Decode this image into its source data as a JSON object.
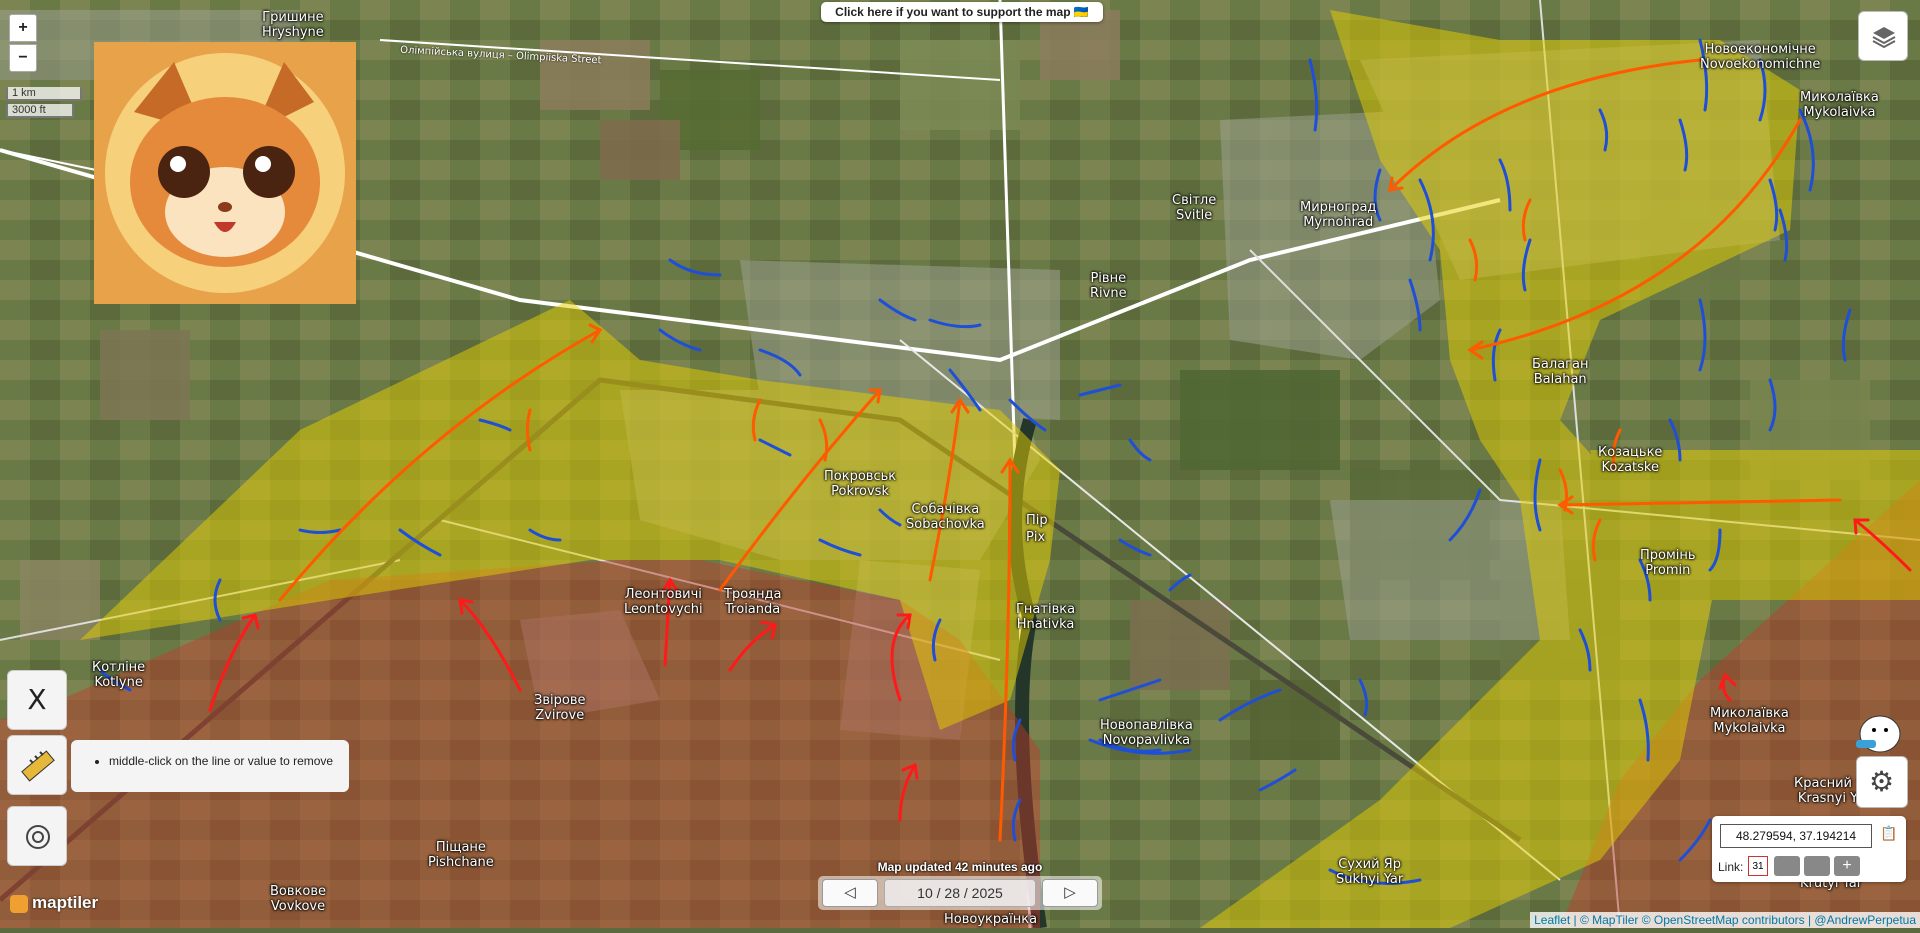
{
  "support_banner": "Click here if you want to support the map 🇺🇦",
  "zoom": {
    "in": "+",
    "out": "−"
  },
  "scale": {
    "metric": "1 km",
    "imperial": "3000 ft"
  },
  "road_label": "Олімпійська вулиця – Olimpiiska Street",
  "places": [
    {
      "uk": "Гришине",
      "en": "Hryshyne"
    },
    {
      "uk": "Світле",
      "en": "Svitle"
    },
    {
      "uk": "Мирноград",
      "en": "Myrnohrad"
    },
    {
      "uk": "Рівне",
      "en": "Rivne"
    },
    {
      "uk": "Новоекономічне",
      "en": "Novoekonomichne"
    },
    {
      "uk": "Миколаївка",
      "en": "Mykolaivka"
    },
    {
      "uk": "Балаган",
      "en": "Balahan"
    },
    {
      "uk": "Козацьке",
      "en": "Kozatske"
    },
    {
      "uk": "Промінь",
      "en": "Promin"
    },
    {
      "uk": "Покровськ",
      "en": "Pokrovsk"
    },
    {
      "uk": "Собачівка",
      "en": "Sobachovka"
    },
    {
      "uk": "Пір",
      "en": "Pir"
    },
    {
      "uk": "Ріх",
      "en": "Rih"
    },
    {
      "uk": "Леонтовичі",
      "en": "Leontovychi"
    },
    {
      "uk": "Троянда",
      "en": "Troianda"
    },
    {
      "uk": "Гнатівка",
      "en": "Hnativka"
    },
    {
      "uk": "Котліне",
      "en": "Kotlyne"
    },
    {
      "uk": "Звірове",
      "en": "Zvirove"
    },
    {
      "uk": "Новопавлівка",
      "en": "Novopavlivka"
    },
    {
      "uk": "Миколаївка",
      "en": "Mykolaivka"
    },
    {
      "uk": "Красний Яр",
      "en": "Krasnyi Yar"
    },
    {
      "uk": "Сухий Яр",
      "en": "Sukhyi Yar"
    },
    {
      "uk": "Піщане",
      "en": "Pishchane"
    },
    {
      "uk": "Вовкове",
      "en": "Vovkove"
    },
    {
      "uk": "Новоукраїнка",
      "en": "Novoukrainka"
    },
    {
      "uk": "",
      "en": "Krutyi Yar"
    }
  ],
  "tooltip": {
    "item": "middle-click on the line or value to remove"
  },
  "x_button": "X",
  "update": {
    "text": "Map updated 42 minutes ago",
    "date": "10 / 28 / 2025",
    "prev": "◁",
    "next": "▷"
  },
  "coords": {
    "value": "48.279594, 37.194214",
    "link_label": "Link:",
    "calendar_day": "31"
  },
  "attribution": {
    "leaflet": "Leaflet",
    "maptiler": "© MapTiler",
    "osm": "© OpenStreetMap contributors",
    "author": "@AndrewPerpetua"
  },
  "logo": "maptiler",
  "colors": {
    "russian_control": "#c0392b",
    "contested": "#e5d000",
    "ukrainian_lines": "#1f4fd6",
    "russian_advance": "#ff5a00",
    "russian_attack": "#ff1a1a"
  }
}
